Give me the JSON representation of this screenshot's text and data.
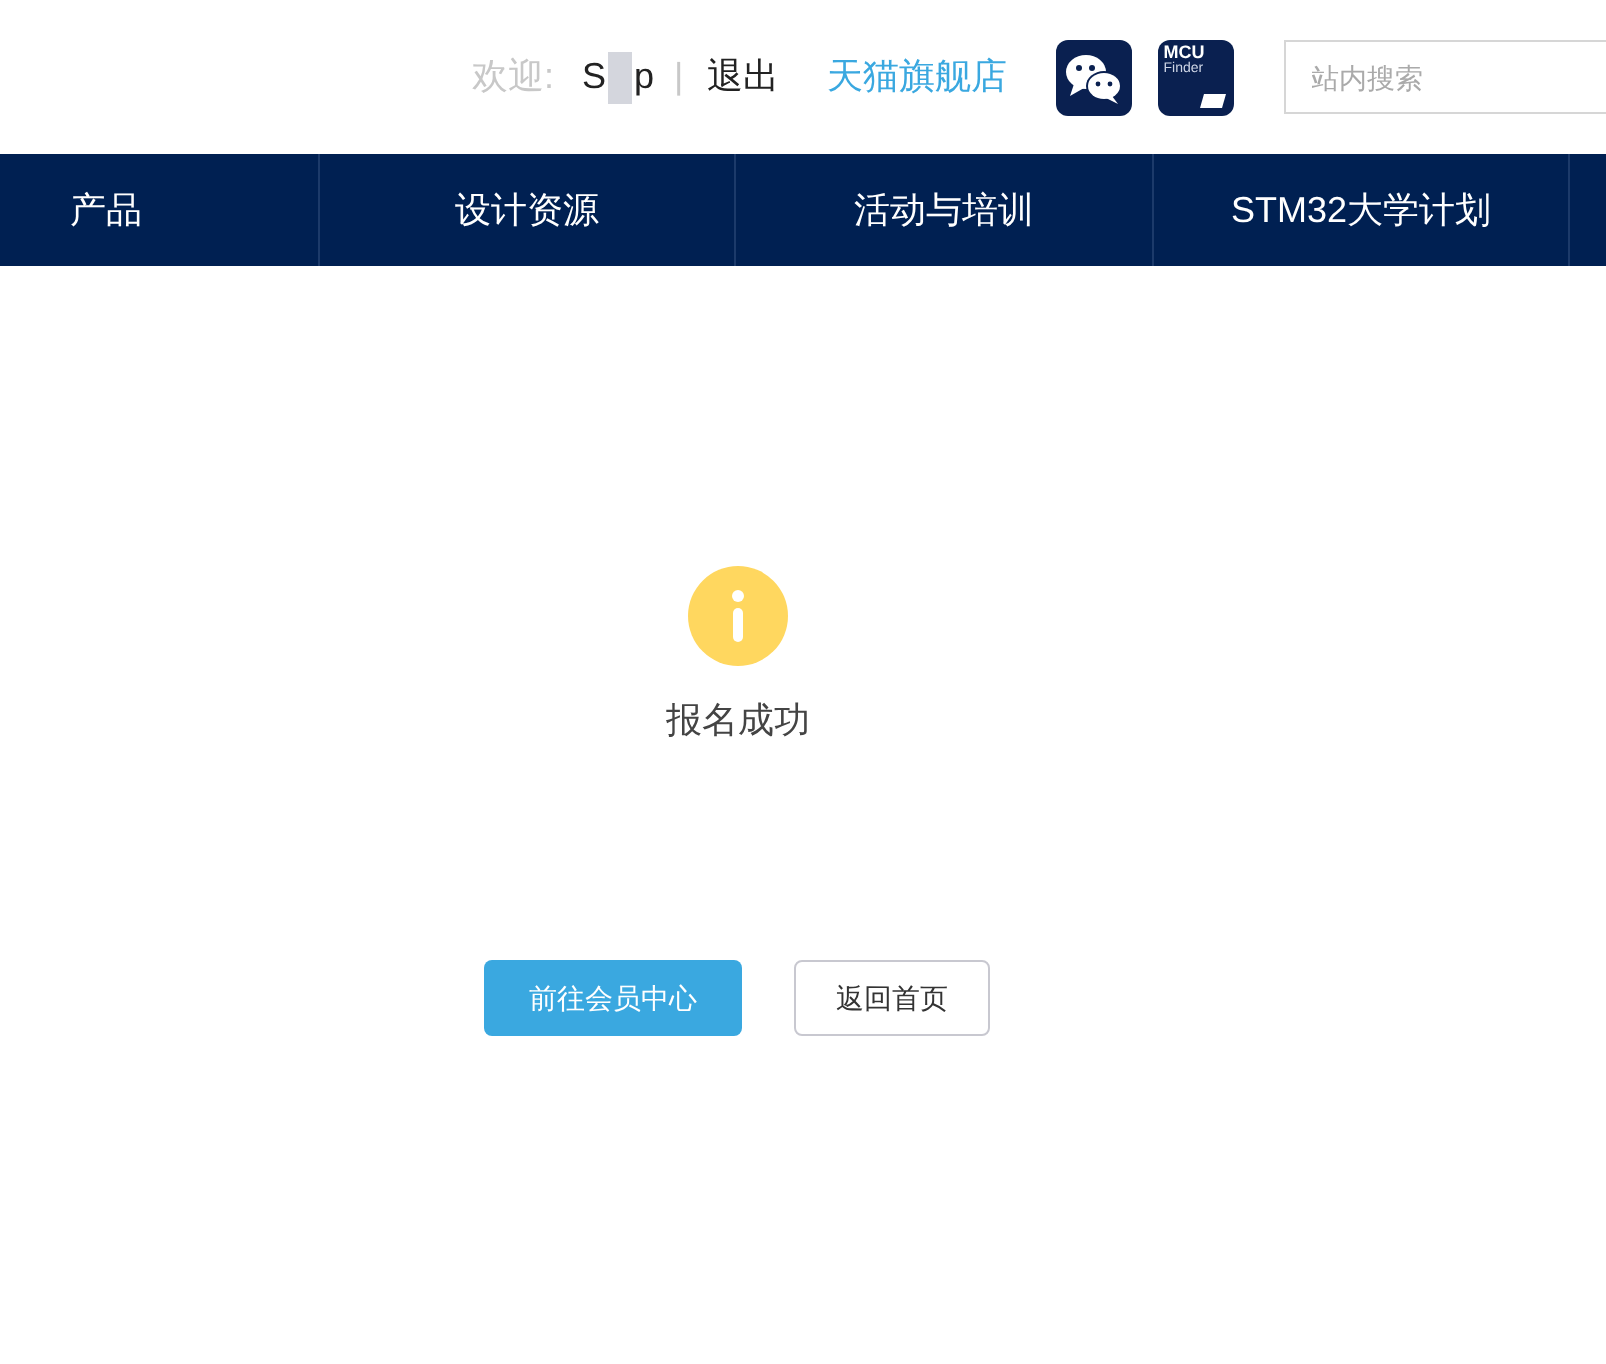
{
  "header": {
    "welcome": "欢迎:",
    "username_start": "S",
    "username_end": "p",
    "separator": "|",
    "logout": "退出",
    "store_link": "天猫旗舰店",
    "mcu_finder": {
      "line1": "MCU",
      "line2": "Finder"
    },
    "search": {
      "placeholder": "站内搜索"
    }
  },
  "nav": [
    {
      "label": "产品"
    },
    {
      "label": "设计资源"
    },
    {
      "label": "活动与培训"
    },
    {
      "label": "STM32大学计划"
    }
  ],
  "result": {
    "message": "报名成功"
  },
  "buttons": [
    {
      "label": "前往会员中心",
      "kind": "primary"
    },
    {
      "label": "返回首页",
      "kind": "secondary"
    }
  ]
}
